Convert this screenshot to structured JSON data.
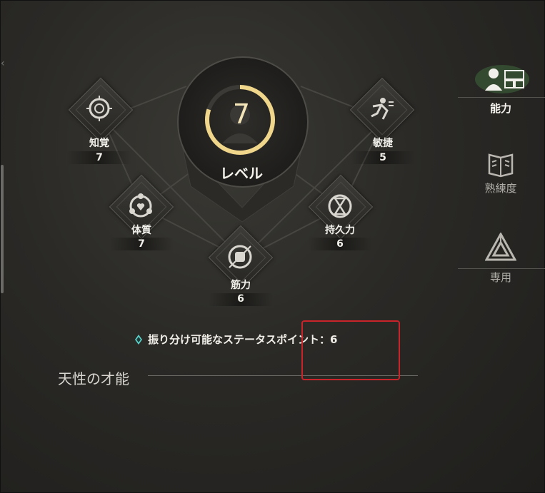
{
  "level": {
    "value": "7",
    "label": "レベル",
    "ring_fraction": 0.8
  },
  "stats": {
    "perception": {
      "label": "知覚",
      "value": "7",
      "icon": "perception-icon"
    },
    "agility": {
      "label": "敏捷",
      "value": "5",
      "icon": "agility-icon"
    },
    "constitution": {
      "label": "体質",
      "value": "7",
      "icon": "constitution-icon"
    },
    "endurance": {
      "label": "持久力",
      "value": "6",
      "icon": "endurance-icon"
    },
    "strength": {
      "label": "筋力",
      "value": "6",
      "icon": "strength-icon"
    }
  },
  "points": {
    "text": "振り分け可能なステータスポイント：6",
    "icon": "gem-icon"
  },
  "section": {
    "title": "天性の才能"
  },
  "sidebar": {
    "items": [
      {
        "label": "能力",
        "icon": "ability-icon",
        "active": true
      },
      {
        "label": "熟練度",
        "icon": "book-icon",
        "active": false
      },
      {
        "label": "専用",
        "icon": "triangle-emblem-icon",
        "active": false
      }
    ]
  },
  "colors": {
    "accent_gold": "#f0d68a",
    "highlight_red": "#c8242a",
    "gem_teal": "#5ad1c8"
  }
}
